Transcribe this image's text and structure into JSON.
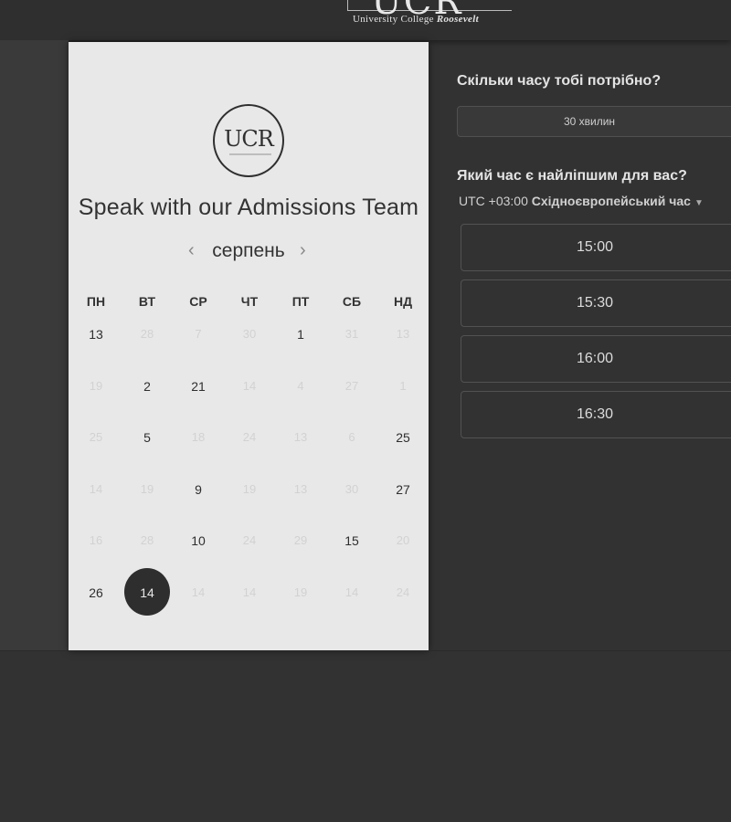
{
  "header": {
    "logo_big": "UCR",
    "logo_sub_regular": "University College ",
    "logo_sub_italic": "Roosevelt"
  },
  "card": {
    "logo_text": "UCR",
    "title": "Speak with our Admissions Team",
    "month": "серпень",
    "prev_icon": "‹",
    "next_icon": "›",
    "weekdays": [
      "ПН",
      "ВТ",
      "СР",
      "ЧТ",
      "ПТ",
      "СБ",
      "НД"
    ],
    "weeks": [
      [
        {
          "d": "13",
          "a": true
        },
        {
          "d": "28",
          "a": false
        },
        {
          "d": "7",
          "a": false
        },
        {
          "d": "30",
          "a": false
        },
        {
          "d": "1",
          "a": true
        },
        {
          "d": "31",
          "a": false
        },
        {
          "d": "13",
          "a": false
        }
      ],
      [
        {
          "d": "19",
          "a": false
        },
        {
          "d": "2",
          "a": true
        },
        {
          "d": "21",
          "a": true
        },
        {
          "d": "14",
          "a": false
        },
        {
          "d": "4",
          "a": false
        },
        {
          "d": "27",
          "a": false
        },
        {
          "d": "1",
          "a": false
        }
      ],
      [
        {
          "d": "25",
          "a": false
        },
        {
          "d": "5",
          "a": true
        },
        {
          "d": "18",
          "a": false
        },
        {
          "d": "24",
          "a": false
        },
        {
          "d": "13",
          "a": false
        },
        {
          "d": "6",
          "a": false
        },
        {
          "d": "25",
          "a": true
        }
      ],
      [
        {
          "d": "14",
          "a": false
        },
        {
          "d": "19",
          "a": false
        },
        {
          "d": "9",
          "a": true
        },
        {
          "d": "19",
          "a": false
        },
        {
          "d": "13",
          "a": false
        },
        {
          "d": "30",
          "a": false
        },
        {
          "d": "27",
          "a": true
        }
      ],
      [
        {
          "d": "16",
          "a": false
        },
        {
          "d": "28",
          "a": false
        },
        {
          "d": "10",
          "a": true
        },
        {
          "d": "24",
          "a": false
        },
        {
          "d": "29",
          "a": false
        },
        {
          "d": "15",
          "a": true
        },
        {
          "d": "20",
          "a": false
        }
      ],
      [
        {
          "d": "26",
          "a": true
        },
        {
          "d": "14",
          "a": true,
          "selected": true
        },
        {
          "d": "14",
          "a": false
        },
        {
          "d": "14",
          "a": false
        },
        {
          "d": "19",
          "a": false
        },
        {
          "d": "14",
          "a": false
        },
        {
          "d": "24",
          "a": false
        }
      ]
    ]
  },
  "booking": {
    "duration_question": "Скільки часу тобі потрібно?",
    "duration_value": "30 хвилин",
    "time_question": "Який час є найліпшим для вас?",
    "timezone_offset": "UTC +03:00 ",
    "timezone_name": "Східноєвропейський час",
    "timezone_caret": "▼",
    "slots": [
      "15:00",
      "15:30",
      "16:00",
      "16:30"
    ]
  },
  "colors": {
    "background": "#323232",
    "card": "#e8e8e8",
    "selected_day": "#2e2e2e",
    "text_light": "#e4e4e4"
  }
}
